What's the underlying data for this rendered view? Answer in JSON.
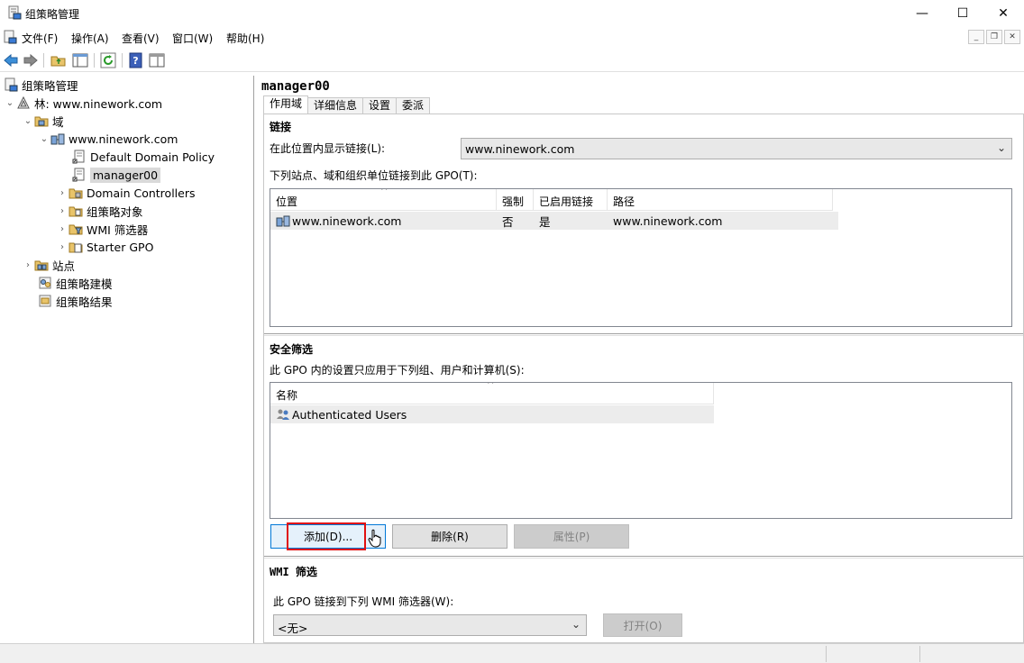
{
  "window": {
    "title": "组策略管理",
    "controls": [
      "—",
      "☐",
      "✕"
    ]
  },
  "menu": {
    "items": [
      "文件(F)",
      "操作(A)",
      "查看(V)",
      "窗口(W)",
      "帮助(H)"
    ]
  },
  "tree": {
    "root": "组策略管理",
    "forest": "林: www.ninework.com",
    "domains": "域",
    "domain": "www.ninework.com",
    "default_policy": "Default Domain Policy",
    "selected": "manager00",
    "domain_controllers": "Domain Controllers",
    "gpo_objects": "组策略对象",
    "wmi_filters": "WMI 筛选器",
    "starter_gpo": "Starter GPO",
    "sites": "站点",
    "modeling": "组策略建模",
    "results": "组策略结果"
  },
  "gpo": {
    "title": "manager00",
    "tabs": [
      "作用域",
      "详细信息",
      "设置",
      "委派"
    ]
  },
  "links": {
    "section_title": "链接",
    "location_label": "在此位置内显示链接(L):",
    "location_value": "www.ninework.com",
    "list_label": "下列站点、域和组织单位链接到此 GPO(T):",
    "columns": [
      "位置",
      "强制",
      "已启用链接",
      "路径"
    ],
    "rows": [
      {
        "location": "www.ninework.com",
        "enforced": "否",
        "enabled": "是",
        "path": "www.ninework.com"
      }
    ]
  },
  "security": {
    "section_title": "安全筛选",
    "list_label": "此 GPO 内的设置只应用于下列组、用户和计算机(S):",
    "column": "名称",
    "rows": [
      "Authenticated Users"
    ],
    "add_button": "添加(D)...",
    "remove_button": "删除(R)",
    "properties_button": "属性(P)"
  },
  "wmi": {
    "section_title": "WMI 筛选",
    "label": "此 GPO 链接到下列 WMI 筛选器(W):",
    "value": "<无>",
    "open_button": "打开(O)"
  },
  "colors": {
    "highlight": "#e01010",
    "selection": "#d9d9d9",
    "row_bg": "#ececec",
    "disabled_btn": "#cccccc"
  }
}
